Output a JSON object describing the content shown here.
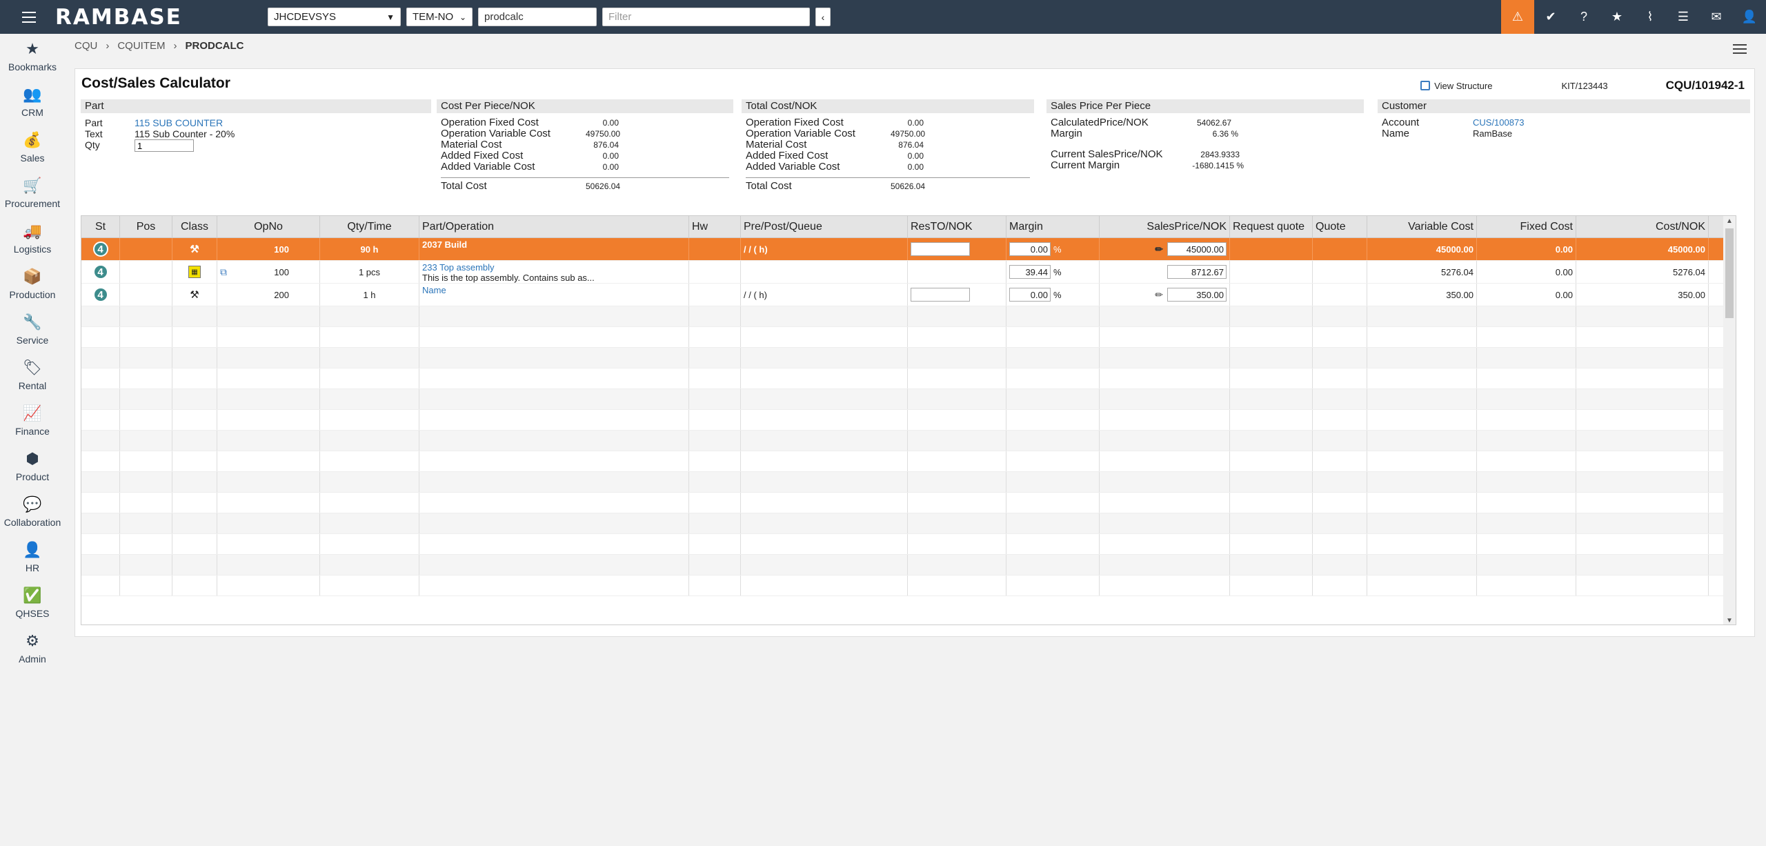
{
  "topbar": {
    "logo": "RAMBASE",
    "company": "JHCDEVSYS",
    "region": "TEM-NO",
    "app_search": "prodcalc",
    "filter_placeholder": "Filter",
    "alert_color": "#f07d2c"
  },
  "sidebar": {
    "items": [
      {
        "label": "Bookmarks",
        "icon": "star-icon"
      },
      {
        "label": "CRM",
        "icon": "people-icon"
      },
      {
        "label": "Sales",
        "icon": "money-bag-icon"
      },
      {
        "label": "Procurement",
        "icon": "cart-icon"
      },
      {
        "label": "Logistics",
        "icon": "truck-icon"
      },
      {
        "label": "Production",
        "icon": "boxes-icon"
      },
      {
        "label": "Service",
        "icon": "wrench-icon"
      },
      {
        "label": "Rental",
        "icon": "rental-icon"
      },
      {
        "label": "Finance",
        "icon": "chart-line-icon"
      },
      {
        "label": "Product",
        "icon": "cube-icon"
      },
      {
        "label": "Collaboration",
        "icon": "chat-icon"
      },
      {
        "label": "HR",
        "icon": "person-icon"
      },
      {
        "label": "QHSES",
        "icon": "check-badge-icon"
      },
      {
        "label": "Admin",
        "icon": "gear-icon"
      }
    ]
  },
  "breadcrumb": {
    "items": [
      "CQU",
      "CQUITEM",
      "PRODCALC"
    ]
  },
  "header": {
    "title": "Cost/Sales Calculator",
    "view_structure": "View Structure",
    "kit": "KIT/123443",
    "id": "CQU/101942-1"
  },
  "part": {
    "header": "Part",
    "part_label": "Part",
    "part_value": "115 SUB COUNTER",
    "text_label": "Text",
    "text_value": "115 Sub Counter - 20%",
    "qty_label": "Qty",
    "qty_value": "1"
  },
  "cost_per_piece": {
    "header": "Cost Per Piece/NOK",
    "rows": [
      {
        "label": "Operation Fixed Cost",
        "value": "0.00"
      },
      {
        "label": "Operation Variable Cost",
        "value": "49750.00"
      },
      {
        "label": "Material Cost",
        "value": "876.04"
      },
      {
        "label": "Added Fixed Cost",
        "value": "0.00"
      },
      {
        "label": "Added Variable Cost",
        "value": "0.00"
      }
    ],
    "total_label": "Total Cost",
    "total_value": "50626.04"
  },
  "total_cost": {
    "header": "Total Cost/NOK",
    "rows": [
      {
        "label": "Operation Fixed Cost",
        "value": "0.00"
      },
      {
        "label": "Operation Variable Cost",
        "value": "49750.00"
      },
      {
        "label": "Material Cost",
        "value": "876.04"
      },
      {
        "label": "Added Fixed Cost",
        "value": "0.00"
      },
      {
        "label": "Added Variable Cost",
        "value": "0.00"
      }
    ],
    "total_label": "Total Cost",
    "total_value": "50626.04"
  },
  "sales_price": {
    "header": "Sales Price Per Piece",
    "calc_label": "CalculatedPrice/NOK",
    "calc_value": "54062.67",
    "margin_label": "Margin",
    "margin_value": "6.36 %",
    "current_label": "Current SalesPrice/NOK",
    "current_value": "2843.9333",
    "current_margin_label": "Current Margin",
    "current_margin_value": "-1680.1415 %"
  },
  "customer": {
    "header": "Customer",
    "account_label": "Account",
    "account_value": "CUS/100873",
    "name_label": "Name",
    "name_value": "RamBase"
  },
  "grid": {
    "columns": [
      "St",
      "Pos",
      "Class",
      "OpNo",
      "Qty/Time",
      "Part/Operation",
      "Hw",
      "Pre/Post/Queue",
      "ResTO/NOK",
      "Margin",
      "SalesPrice/NOK",
      "Request quote",
      "Quote",
      "Variable Cost",
      "Fixed Cost",
      "Cost/NOK"
    ],
    "rows": [
      {
        "st": "4",
        "opno": "100",
        "qty": "90 h",
        "part": "2037 Build",
        "part_desc": "",
        "ppq": "/ / ( h)",
        "margin": "0.00",
        "pct": "%",
        "sales": "45000.00",
        "var": "45000.00",
        "fixed": "0.00",
        "cost": "45000.00"
      },
      {
        "st": "4",
        "opno": "100",
        "qty": "1 pcs",
        "part": "233 Top assembly",
        "part_desc": "This is the top assembly. Contains sub as...",
        "ppq": "",
        "margin": "39.44",
        "pct": "%",
        "sales": "8712.67",
        "var": "5276.04",
        "fixed": "0.00",
        "cost": "5276.04"
      },
      {
        "st": "4",
        "opno": "200",
        "qty": "1 h",
        "part": "Name",
        "part_desc": "",
        "ppq": "/ / ( h)",
        "margin": "0.00",
        "pct": "%",
        "sales": "350.00",
        "var": "350.00",
        "fixed": "0.00",
        "cost": "350.00"
      }
    ]
  }
}
